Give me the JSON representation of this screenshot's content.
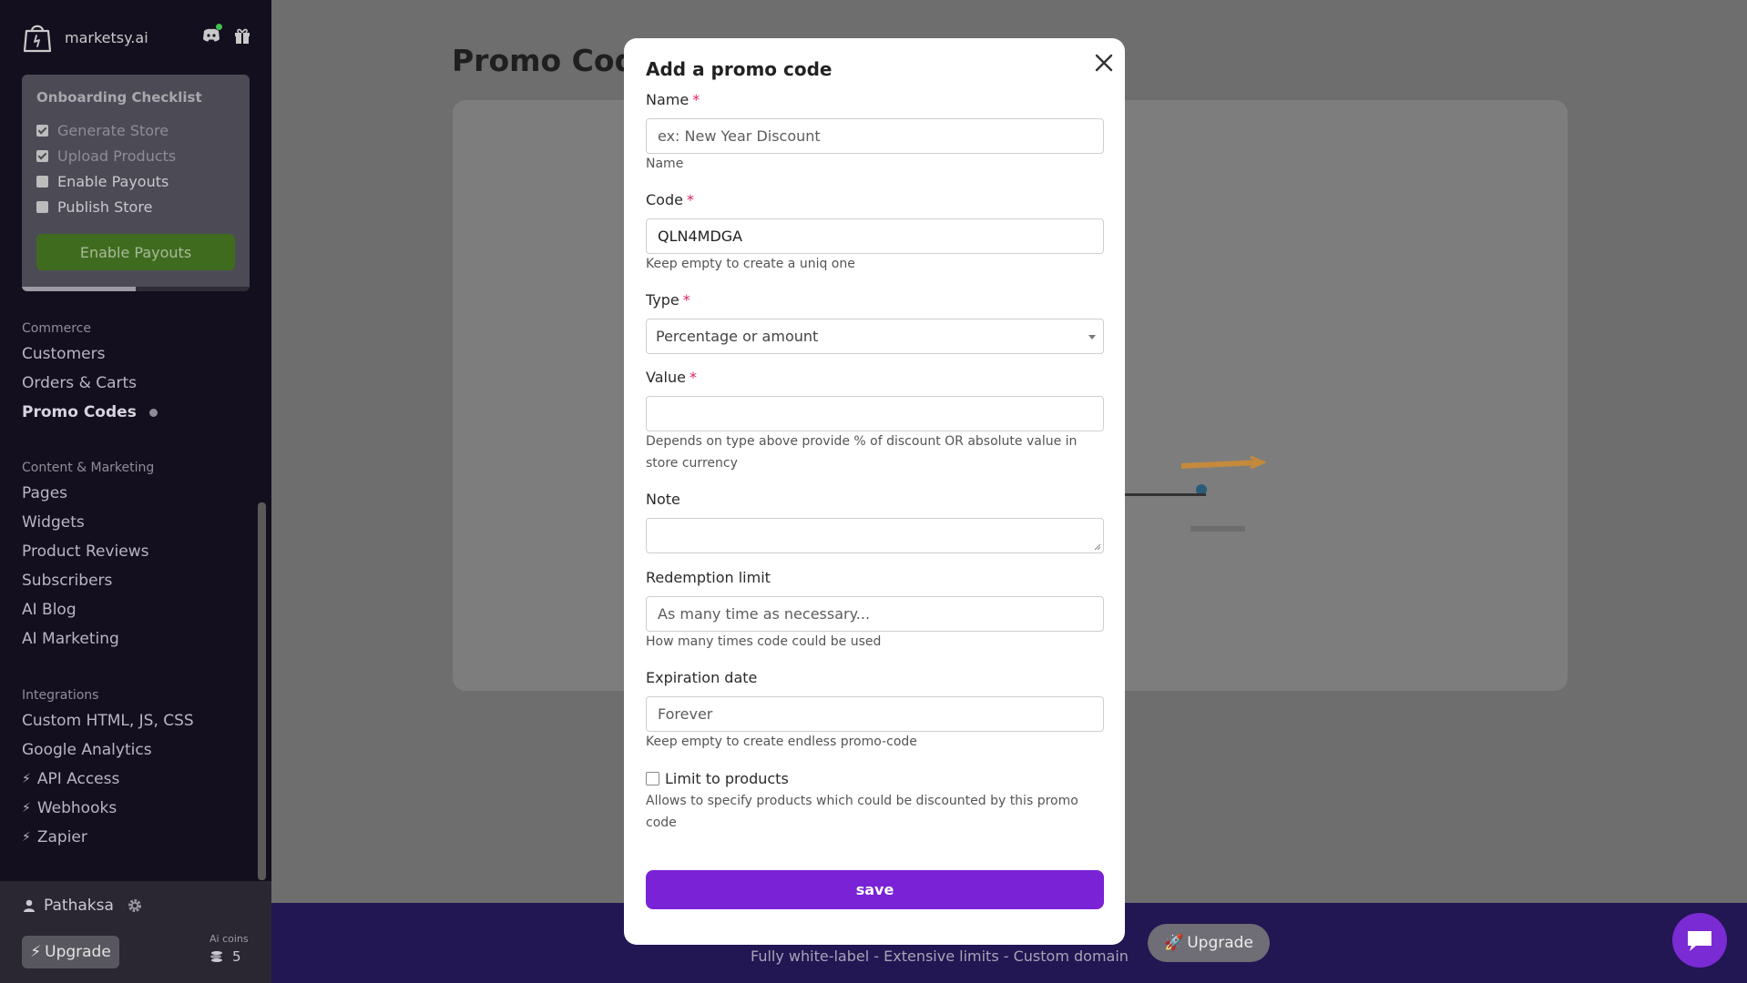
{
  "brand": {
    "name": "marketsy.ai"
  },
  "header_icons": [
    "discord-icon",
    "gift-icon"
  ],
  "checklist": {
    "title": "Onboarding Checklist",
    "items": [
      {
        "label": "Generate Store",
        "checked": true
      },
      {
        "label": "Upload Products",
        "checked": true
      },
      {
        "label": "Enable Payouts",
        "checked": false
      },
      {
        "label": "Publish Store",
        "checked": false
      }
    ],
    "button": "Enable Payouts",
    "progress": 0.5
  },
  "sidebar": {
    "sections": [
      {
        "title": "Commerce",
        "items": [
          "Customers",
          "Orders & Carts",
          "Promo Codes"
        ]
      },
      {
        "title": "Content & Marketing",
        "items": [
          "Pages",
          "Widgets",
          "Product Reviews",
          "Subscribers",
          "AI Blog",
          "AI Marketing"
        ]
      },
      {
        "title": "Integrations",
        "items": [
          "Custom HTML, JS, CSS",
          "Google Analytics",
          "API Access",
          "Webhooks",
          "Zapier"
        ]
      }
    ],
    "active_item": "Promo Codes"
  },
  "user": {
    "name": "Pathaksa",
    "upgrade": "Upgrade",
    "coins_label": "Ai coins",
    "coins": "5"
  },
  "page": {
    "title": "Promo Codes"
  },
  "banner": {
    "text": "Fully white-label - Extensive limits - Custom domain",
    "upgrade": "Upgrade"
  },
  "modal": {
    "title": "Add a promo code",
    "required_mark": "*",
    "name": {
      "label": "Name",
      "placeholder": "ex: New Year Discount",
      "help": "Name"
    },
    "code": {
      "label": "Code",
      "value": "QLN4MDGA",
      "help": "Keep empty to create a uniq one"
    },
    "type": {
      "label": "Type",
      "value": "Percentage or amount"
    },
    "value": {
      "label": "Value",
      "help": "Depends on type above provide % of discount OR absolute value in store currency"
    },
    "note": {
      "label": "Note"
    },
    "redemption": {
      "label": "Redemption limit",
      "placeholder": "As many time as necessary...",
      "help": "How many times code could be used"
    },
    "expiration": {
      "label": "Expiration date",
      "placeholder": "Forever",
      "help": "Keep empty to create endless promo-code"
    },
    "limit": {
      "label": "Limit to products",
      "checked": false,
      "help": "Allows to specify products which could be discounted by this promo code"
    },
    "save": "save"
  },
  "colors": {
    "sidebar_bg": "#140f1e",
    "accent": "#7a22d6",
    "checklist_button": "#3f6b1f",
    "banner_bg": "#221653",
    "required": "#e0245e"
  }
}
